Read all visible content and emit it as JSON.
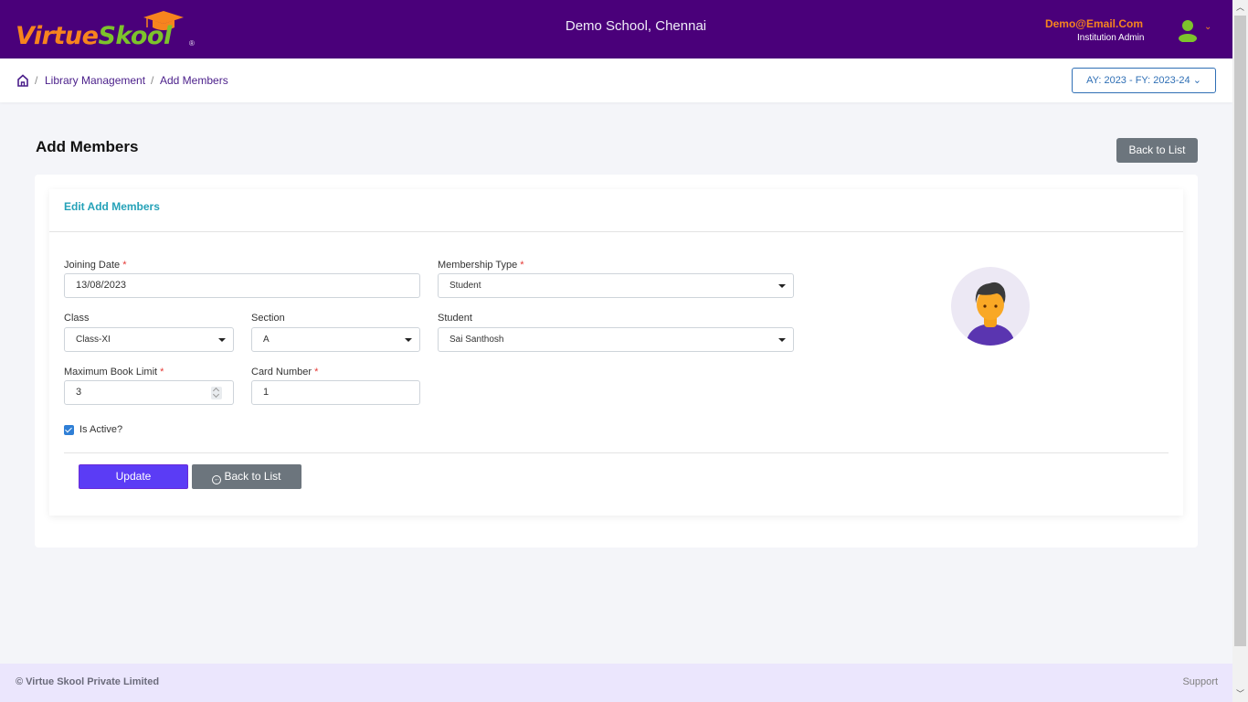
{
  "header": {
    "logo_part1": "Virtue",
    "logo_part2": "Skool",
    "logo_reg": "®",
    "school_name": "Demo School, Chennai",
    "user_email": "Demo@Email.Com",
    "user_role": "Institution Admin",
    "caret": "⌄"
  },
  "breadcrumb": {
    "items": [
      "Library Management",
      "Add Members"
    ],
    "separator": "/"
  },
  "academic_year": {
    "label": "AY: 2023 - FY: 2023-24 ⌄"
  },
  "page": {
    "title": "Add Members",
    "back_top_label": "Back to List"
  },
  "form": {
    "card_title": "Edit Add Members",
    "required_mark": "*",
    "joining_date": {
      "label": "Joining Date",
      "value": "13/08/2023"
    },
    "membership_type": {
      "label": "Membership Type",
      "value": "Student"
    },
    "class": {
      "label": "Class",
      "value": "Class-XI"
    },
    "section": {
      "label": "Section",
      "value": "A"
    },
    "student": {
      "label": "Student",
      "value": "Sai Santhosh"
    },
    "max_book_limit": {
      "label": "Maximum Book Limit",
      "value": "3"
    },
    "card_number": {
      "label": "Card Number",
      "value": "1"
    },
    "is_active": {
      "label": "Is Active?",
      "checked": true
    },
    "update_label": "Update",
    "back_label": "Back to List",
    "back_icon": "←"
  },
  "footer": {
    "copyright": "© Virtue Skool Private Limited",
    "support": "Support"
  },
  "scrollbar": {
    "up": "︿",
    "down": "﹀"
  },
  "colors": {
    "topbar": "#4a007a",
    "logo_orange": "#f7841e",
    "logo_green": "#7dc32c",
    "primary_button": "#5b3cf5",
    "secondary_button": "#6c757d",
    "card_title": "#25a2b8",
    "footer_bg": "#ebe6fd"
  }
}
